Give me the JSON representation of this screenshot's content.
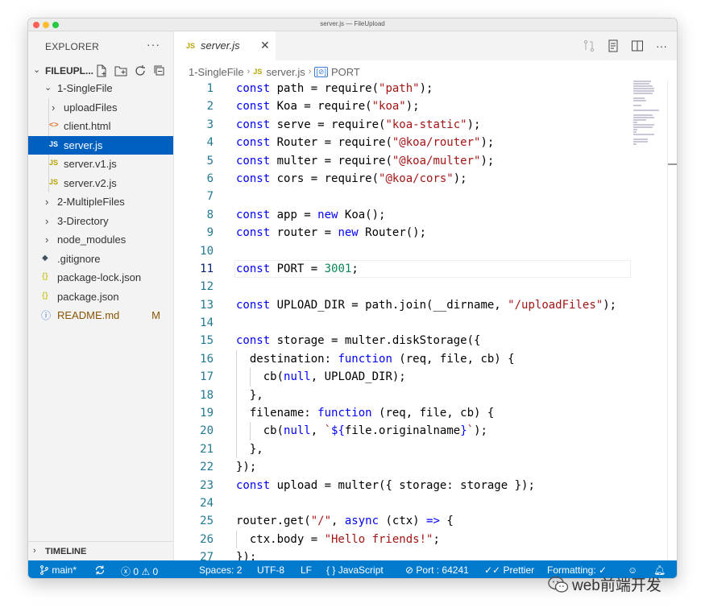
{
  "window": {
    "title": "server.js — FileUpload"
  },
  "sidebar": {
    "title": "EXPLORER",
    "more": "···",
    "folder": "FILEUPL...",
    "items": [
      {
        "label": "1-SingleFile",
        "kind": "folder-open",
        "depth": 1
      },
      {
        "label": "uploadFiles",
        "kind": "folder",
        "depth": 2
      },
      {
        "label": "client.html",
        "kind": "html",
        "depth": 2
      },
      {
        "label": "server.js",
        "kind": "js",
        "depth": 2,
        "selected": true
      },
      {
        "label": "server.v1.js",
        "kind": "js",
        "depth": 2
      },
      {
        "label": "server.v2.js",
        "kind": "js",
        "depth": 2
      },
      {
        "label": "2-MultipleFiles",
        "kind": "folder",
        "depth": 1
      },
      {
        "label": "3-Directory",
        "kind": "folder",
        "depth": 1
      },
      {
        "label": "node_modules",
        "kind": "folder",
        "depth": 1
      },
      {
        "label": ".gitignore",
        "kind": "git",
        "depth": 1
      },
      {
        "label": "package-lock.json",
        "kind": "json",
        "depth": 1
      },
      {
        "label": "package.json",
        "kind": "json",
        "depth": 1
      },
      {
        "label": "README.md",
        "kind": "info",
        "depth": 1,
        "badge": "M"
      }
    ],
    "timeline": "TIMELINE"
  },
  "tab": {
    "icon": "JS",
    "name": "server.js",
    "close": "✕"
  },
  "breadcrumb": {
    "folder": "1-SingleFile",
    "file_icon": "JS",
    "file": "server.js",
    "symbol": "PORT"
  },
  "code_lines": [
    "1",
    "2",
    "3",
    "4",
    "5",
    "6",
    "7",
    "8",
    "9",
    "10",
    "11",
    "12",
    "13",
    "14",
    "15",
    "16",
    "17",
    "18",
    "19",
    "20",
    "21",
    "22",
    "23",
    "24",
    "25",
    "26",
    "27"
  ],
  "status": {
    "branch": "main*",
    "errors": "0",
    "warnings": "0",
    "spaces": "Spaces: 2",
    "encoding": "UTF-8",
    "eol": "LF",
    "language": "JavaScript",
    "port": "Port : 64241",
    "prettier": "Prettier",
    "formatting": "Formatting: ✓"
  },
  "watermark": "web前端开发",
  "colors": {
    "accent": "#007acc",
    "selection": "#0060c0",
    "keyword": "#0000ff",
    "string": "#a31515",
    "number": "#098658"
  }
}
